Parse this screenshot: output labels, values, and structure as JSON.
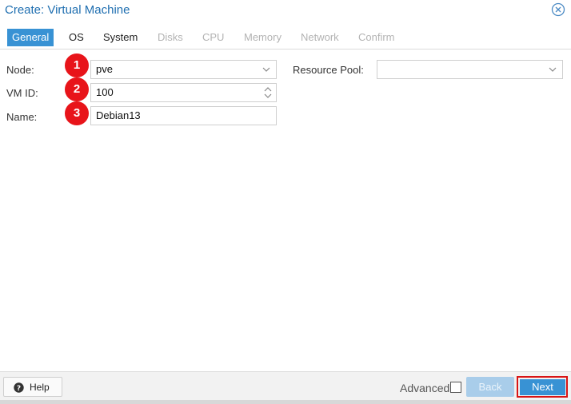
{
  "window": {
    "title": "Create: Virtual Machine",
    "close_icon": "close-circle-icon"
  },
  "tabs": [
    {
      "label": "General",
      "state": "active"
    },
    {
      "label": "OS",
      "state": "enabled"
    },
    {
      "label": "System",
      "state": "enabled"
    },
    {
      "label": "Disks",
      "state": "disabled"
    },
    {
      "label": "CPU",
      "state": "disabled"
    },
    {
      "label": "Memory",
      "state": "disabled"
    },
    {
      "label": "Network",
      "state": "disabled"
    },
    {
      "label": "Confirm",
      "state": "disabled"
    }
  ],
  "form": {
    "node": {
      "label": "Node:",
      "value": "pve"
    },
    "vmid": {
      "label": "VM ID:",
      "value": "100"
    },
    "name": {
      "label": "Name:",
      "value": "Debian13"
    },
    "resource_pool": {
      "label": "Resource Pool:",
      "value": ""
    }
  },
  "annotations": [
    "1",
    "2",
    "3"
  ],
  "footer": {
    "help_label": "Help",
    "advanced_label": "Advanced",
    "back_label": "Back",
    "next_label": "Next"
  },
  "colors": {
    "accent": "#3892d4",
    "title": "#1e6eb0",
    "badge": "#e8141a",
    "highlight": "#d81414"
  }
}
